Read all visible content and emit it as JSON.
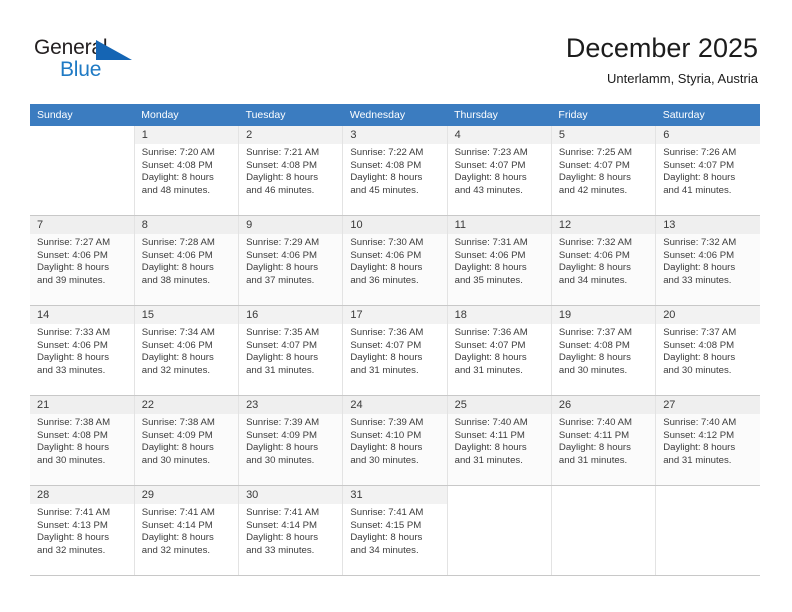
{
  "brand": {
    "name_top": "General",
    "name_bottom": "Blue",
    "triangle_color": "#1565b4",
    "blue_text_color": "#1f7ac4"
  },
  "header": {
    "title": "December 2025",
    "subtitle": "Unterlamm, Styria, Austria",
    "header_bg": "#3b7cc0"
  },
  "weekday_headers": [
    "Sunday",
    "Monday",
    "Tuesday",
    "Wednesday",
    "Thursday",
    "Friday",
    "Saturday"
  ],
  "weeks": [
    [
      {
        "day": "",
        "sunrise": "",
        "sunset": "",
        "daylight1": "",
        "daylight2": ""
      },
      {
        "day": "1",
        "sunrise": "Sunrise: 7:20 AM",
        "sunset": "Sunset: 4:08 PM",
        "daylight1": "Daylight: 8 hours",
        "daylight2": "and 48 minutes."
      },
      {
        "day": "2",
        "sunrise": "Sunrise: 7:21 AM",
        "sunset": "Sunset: 4:08 PM",
        "daylight1": "Daylight: 8 hours",
        "daylight2": "and 46 minutes."
      },
      {
        "day": "3",
        "sunrise": "Sunrise: 7:22 AM",
        "sunset": "Sunset: 4:08 PM",
        "daylight1": "Daylight: 8 hours",
        "daylight2": "and 45 minutes."
      },
      {
        "day": "4",
        "sunrise": "Sunrise: 7:23 AM",
        "sunset": "Sunset: 4:07 PM",
        "daylight1": "Daylight: 8 hours",
        "daylight2": "and 43 minutes."
      },
      {
        "day": "5",
        "sunrise": "Sunrise: 7:25 AM",
        "sunset": "Sunset: 4:07 PM",
        "daylight1": "Daylight: 8 hours",
        "daylight2": "and 42 minutes."
      },
      {
        "day": "6",
        "sunrise": "Sunrise: 7:26 AM",
        "sunset": "Sunset: 4:07 PM",
        "daylight1": "Daylight: 8 hours",
        "daylight2": "and 41 minutes."
      }
    ],
    [
      {
        "day": "7",
        "sunrise": "Sunrise: 7:27 AM",
        "sunset": "Sunset: 4:06 PM",
        "daylight1": "Daylight: 8 hours",
        "daylight2": "and 39 minutes."
      },
      {
        "day": "8",
        "sunrise": "Sunrise: 7:28 AM",
        "sunset": "Sunset: 4:06 PM",
        "daylight1": "Daylight: 8 hours",
        "daylight2": "and 38 minutes."
      },
      {
        "day": "9",
        "sunrise": "Sunrise: 7:29 AM",
        "sunset": "Sunset: 4:06 PM",
        "daylight1": "Daylight: 8 hours",
        "daylight2": "and 37 minutes."
      },
      {
        "day": "10",
        "sunrise": "Sunrise: 7:30 AM",
        "sunset": "Sunset: 4:06 PM",
        "daylight1": "Daylight: 8 hours",
        "daylight2": "and 36 minutes."
      },
      {
        "day": "11",
        "sunrise": "Sunrise: 7:31 AM",
        "sunset": "Sunset: 4:06 PM",
        "daylight1": "Daylight: 8 hours",
        "daylight2": "and 35 minutes."
      },
      {
        "day": "12",
        "sunrise": "Sunrise: 7:32 AM",
        "sunset": "Sunset: 4:06 PM",
        "daylight1": "Daylight: 8 hours",
        "daylight2": "and 34 minutes."
      },
      {
        "day": "13",
        "sunrise": "Sunrise: 7:32 AM",
        "sunset": "Sunset: 4:06 PM",
        "daylight1": "Daylight: 8 hours",
        "daylight2": "and 33 minutes."
      }
    ],
    [
      {
        "day": "14",
        "sunrise": "Sunrise: 7:33 AM",
        "sunset": "Sunset: 4:06 PM",
        "daylight1": "Daylight: 8 hours",
        "daylight2": "and 33 minutes."
      },
      {
        "day": "15",
        "sunrise": "Sunrise: 7:34 AM",
        "sunset": "Sunset: 4:06 PM",
        "daylight1": "Daylight: 8 hours",
        "daylight2": "and 32 minutes."
      },
      {
        "day": "16",
        "sunrise": "Sunrise: 7:35 AM",
        "sunset": "Sunset: 4:07 PM",
        "daylight1": "Daylight: 8 hours",
        "daylight2": "and 31 minutes."
      },
      {
        "day": "17",
        "sunrise": "Sunrise: 7:36 AM",
        "sunset": "Sunset: 4:07 PM",
        "daylight1": "Daylight: 8 hours",
        "daylight2": "and 31 minutes."
      },
      {
        "day": "18",
        "sunrise": "Sunrise: 7:36 AM",
        "sunset": "Sunset: 4:07 PM",
        "daylight1": "Daylight: 8 hours",
        "daylight2": "and 31 minutes."
      },
      {
        "day": "19",
        "sunrise": "Sunrise: 7:37 AM",
        "sunset": "Sunset: 4:08 PM",
        "daylight1": "Daylight: 8 hours",
        "daylight2": "and 30 minutes."
      },
      {
        "day": "20",
        "sunrise": "Sunrise: 7:37 AM",
        "sunset": "Sunset: 4:08 PM",
        "daylight1": "Daylight: 8 hours",
        "daylight2": "and 30 minutes."
      }
    ],
    [
      {
        "day": "21",
        "sunrise": "Sunrise: 7:38 AM",
        "sunset": "Sunset: 4:08 PM",
        "daylight1": "Daylight: 8 hours",
        "daylight2": "and 30 minutes."
      },
      {
        "day": "22",
        "sunrise": "Sunrise: 7:38 AM",
        "sunset": "Sunset: 4:09 PM",
        "daylight1": "Daylight: 8 hours",
        "daylight2": "and 30 minutes."
      },
      {
        "day": "23",
        "sunrise": "Sunrise: 7:39 AM",
        "sunset": "Sunset: 4:09 PM",
        "daylight1": "Daylight: 8 hours",
        "daylight2": "and 30 minutes."
      },
      {
        "day": "24",
        "sunrise": "Sunrise: 7:39 AM",
        "sunset": "Sunset: 4:10 PM",
        "daylight1": "Daylight: 8 hours",
        "daylight2": "and 30 minutes."
      },
      {
        "day": "25",
        "sunrise": "Sunrise: 7:40 AM",
        "sunset": "Sunset: 4:11 PM",
        "daylight1": "Daylight: 8 hours",
        "daylight2": "and 31 minutes."
      },
      {
        "day": "26",
        "sunrise": "Sunrise: 7:40 AM",
        "sunset": "Sunset: 4:11 PM",
        "daylight1": "Daylight: 8 hours",
        "daylight2": "and 31 minutes."
      },
      {
        "day": "27",
        "sunrise": "Sunrise: 7:40 AM",
        "sunset": "Sunset: 4:12 PM",
        "daylight1": "Daylight: 8 hours",
        "daylight2": "and 31 minutes."
      }
    ],
    [
      {
        "day": "28",
        "sunrise": "Sunrise: 7:41 AM",
        "sunset": "Sunset: 4:13 PM",
        "daylight1": "Daylight: 8 hours",
        "daylight2": "and 32 minutes."
      },
      {
        "day": "29",
        "sunrise": "Sunrise: 7:41 AM",
        "sunset": "Sunset: 4:14 PM",
        "daylight1": "Daylight: 8 hours",
        "daylight2": "and 32 minutes."
      },
      {
        "day": "30",
        "sunrise": "Sunrise: 7:41 AM",
        "sunset": "Sunset: 4:14 PM",
        "daylight1": "Daylight: 8 hours",
        "daylight2": "and 33 minutes."
      },
      {
        "day": "31",
        "sunrise": "Sunrise: 7:41 AM",
        "sunset": "Sunset: 4:15 PM",
        "daylight1": "Daylight: 8 hours",
        "daylight2": "and 34 minutes."
      },
      {
        "day": "",
        "sunrise": "",
        "sunset": "",
        "daylight1": "",
        "daylight2": ""
      },
      {
        "day": "",
        "sunrise": "",
        "sunset": "",
        "daylight1": "",
        "daylight2": ""
      },
      {
        "day": "",
        "sunrise": "",
        "sunset": "",
        "daylight1": "",
        "daylight2": ""
      }
    ]
  ]
}
